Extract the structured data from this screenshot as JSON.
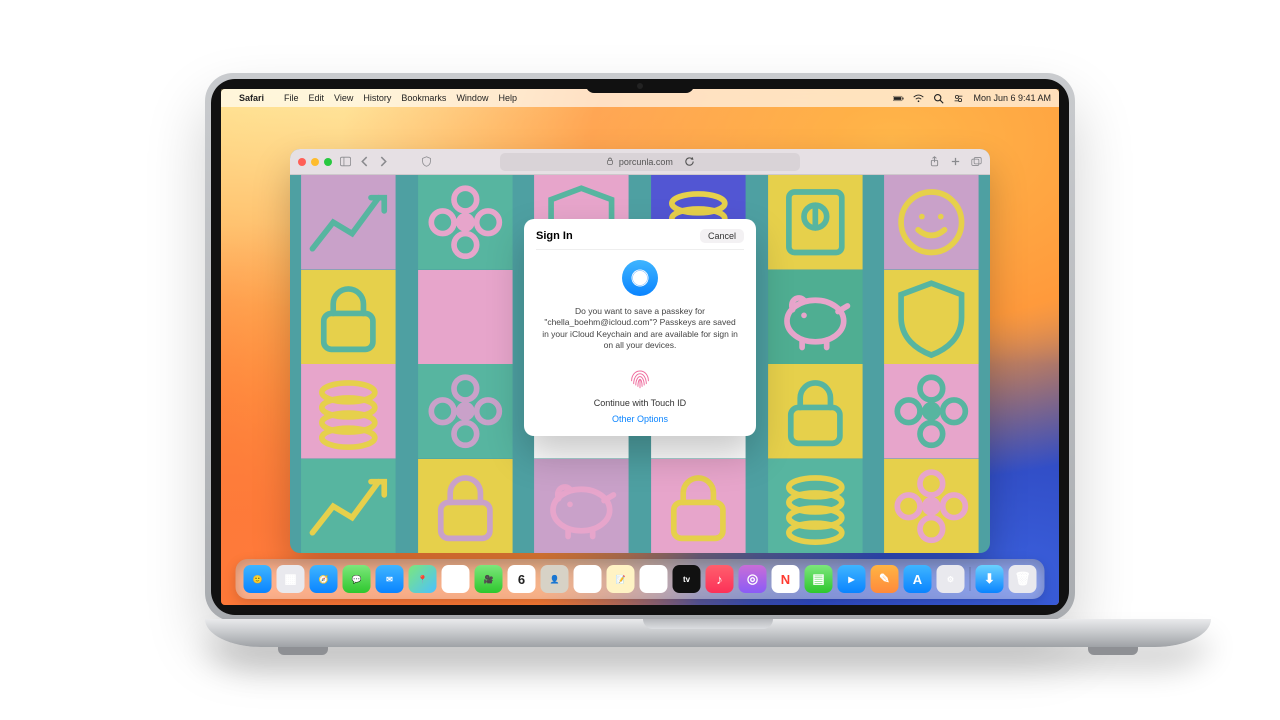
{
  "menubar": {
    "app": "Safari",
    "items": [
      "File",
      "Edit",
      "View",
      "History",
      "Bookmarks",
      "Window",
      "Help"
    ],
    "clock": "Mon Jun 6  9:41 AM"
  },
  "safari": {
    "address": "porcunla.com"
  },
  "dialog": {
    "title": "Sign In",
    "cancel": "Cancel",
    "body": "Do you want to save a passkey for \"chella_boehm@icloud.com\"? Passkeys are saved in your iCloud Keychain and are available for sign in on all your devices.",
    "continue_label": "Continue with Touch ID",
    "other_label": "Other Options"
  },
  "dock": {
    "apps": [
      {
        "name": "finder",
        "bg": "linear-gradient(180deg,#3fb5ff,#0a84ff)",
        "glyph": "🙂"
      },
      {
        "name": "launchpad",
        "bg": "#e9e9ee",
        "glyph": "▦"
      },
      {
        "name": "safari",
        "bg": "linear-gradient(180deg,#3fb5ff,#0a84ff)",
        "glyph": "🧭"
      },
      {
        "name": "messages",
        "bg": "linear-gradient(180deg,#7CE77B,#2EC72E)",
        "glyph": "💬"
      },
      {
        "name": "mail",
        "bg": "linear-gradient(180deg,#3fb5ff,#0a84ff)",
        "glyph": "✉︎"
      },
      {
        "name": "maps",
        "bg": "linear-gradient(135deg,#7CE77B,#4cc0ff)",
        "glyph": "📍"
      },
      {
        "name": "photos",
        "bg": "#fff",
        "glyph": "✿"
      },
      {
        "name": "facetime",
        "bg": "linear-gradient(180deg,#7CE77B,#2EC72E)",
        "glyph": "🎥"
      },
      {
        "name": "calendar",
        "bg": "#fff",
        "glyph": "6"
      },
      {
        "name": "contacts",
        "bg": "#d7d2c6",
        "glyph": "👤"
      },
      {
        "name": "reminders",
        "bg": "#fff",
        "glyph": "☑︎"
      },
      {
        "name": "notes",
        "bg": "#fff3c4",
        "glyph": "📝"
      },
      {
        "name": "freeform",
        "bg": "#fff",
        "glyph": "✎"
      },
      {
        "name": "tv",
        "bg": "#111",
        "glyph": "tv"
      },
      {
        "name": "music",
        "bg": "linear-gradient(180deg,#ff5f6d,#fc3158)",
        "glyph": "♪"
      },
      {
        "name": "podcasts",
        "bg": "linear-gradient(180deg,#c86dd7,#8b5cf6)",
        "glyph": "◎"
      },
      {
        "name": "news",
        "bg": "#fff",
        "glyph": "N"
      },
      {
        "name": "numbers",
        "bg": "linear-gradient(180deg,#7CE77B,#2EC72E)",
        "glyph": "▤"
      },
      {
        "name": "keynote",
        "bg": "linear-gradient(180deg,#3fb5ff,#0a84ff)",
        "glyph": "▶︎"
      },
      {
        "name": "pages",
        "bg": "linear-gradient(180deg,#ffb443,#ff8a3c)",
        "glyph": "✎"
      },
      {
        "name": "appstore",
        "bg": "linear-gradient(180deg,#3fb5ff,#0a84ff)",
        "glyph": "A"
      },
      {
        "name": "system-settings",
        "bg": "#e9e9ee",
        "glyph": "⚙︎"
      }
    ],
    "trash": {
      "name": "trash",
      "bg": "#e9e9ee",
      "glyph": "🗑"
    }
  },
  "tiles": [
    {
      "bg": "#c9a1c9",
      "shape": "chart",
      "fg": "#57b5a0"
    },
    {
      "bg": "#57b5a0",
      "shape": "flower",
      "fg": "#e7a5cb"
    },
    {
      "bg": "#e7a5cb",
      "shape": "shield",
      "fg": "#57b5a0"
    },
    {
      "bg": "#5256d3",
      "shape": "coins",
      "fg": "#e6d04b"
    },
    {
      "bg": "#e6d04b",
      "shape": "note",
      "fg": "#57b5a0"
    },
    {
      "bg": "#c9a1c9",
      "shape": "smile",
      "fg": "#e6d04b"
    },
    {
      "bg": "#e6d04b",
      "shape": "lock",
      "fg": "#57b5a0"
    },
    {
      "bg": "#e7a5cb",
      "shape": "blank",
      "fg": "#e7a5cb"
    },
    {
      "bg": "#ffffff",
      "shape": "blank",
      "fg": "#ffffff"
    },
    {
      "bg": "#ffffff",
      "shape": "blank",
      "fg": "#ffffff"
    },
    {
      "bg": "#4fae92",
      "shape": "piggy",
      "fg": "#e7a5cb"
    },
    {
      "bg": "#e6d04b",
      "shape": "shield",
      "fg": "#57b5a0"
    },
    {
      "bg": "#e7a5cb",
      "shape": "coins",
      "fg": "#e6d04b"
    },
    {
      "bg": "#57b5a0",
      "shape": "flower",
      "fg": "#c9a1c9"
    },
    {
      "bg": "#ffffff",
      "shape": "blank",
      "fg": "#ffffff"
    },
    {
      "bg": "#ffffff",
      "shape": "blank",
      "fg": "#ffffff"
    },
    {
      "bg": "#e6d04b",
      "shape": "lock",
      "fg": "#57b5a0"
    },
    {
      "bg": "#e7a5cb",
      "shape": "flower",
      "fg": "#57b5a0"
    },
    {
      "bg": "#57b5a0",
      "shape": "chart",
      "fg": "#e6d04b"
    },
    {
      "bg": "#e6d04b",
      "shape": "lock",
      "fg": "#c9a1c9"
    },
    {
      "bg": "#c9a1c9",
      "shape": "piggy",
      "fg": "#e7a5cb"
    },
    {
      "bg": "#e7a5cb",
      "shape": "lock",
      "fg": "#e6d04b"
    },
    {
      "bg": "#57b5a0",
      "shape": "coins",
      "fg": "#e6d04b"
    },
    {
      "bg": "#e6d04b",
      "shape": "flower",
      "fg": "#e7a5cb"
    }
  ]
}
